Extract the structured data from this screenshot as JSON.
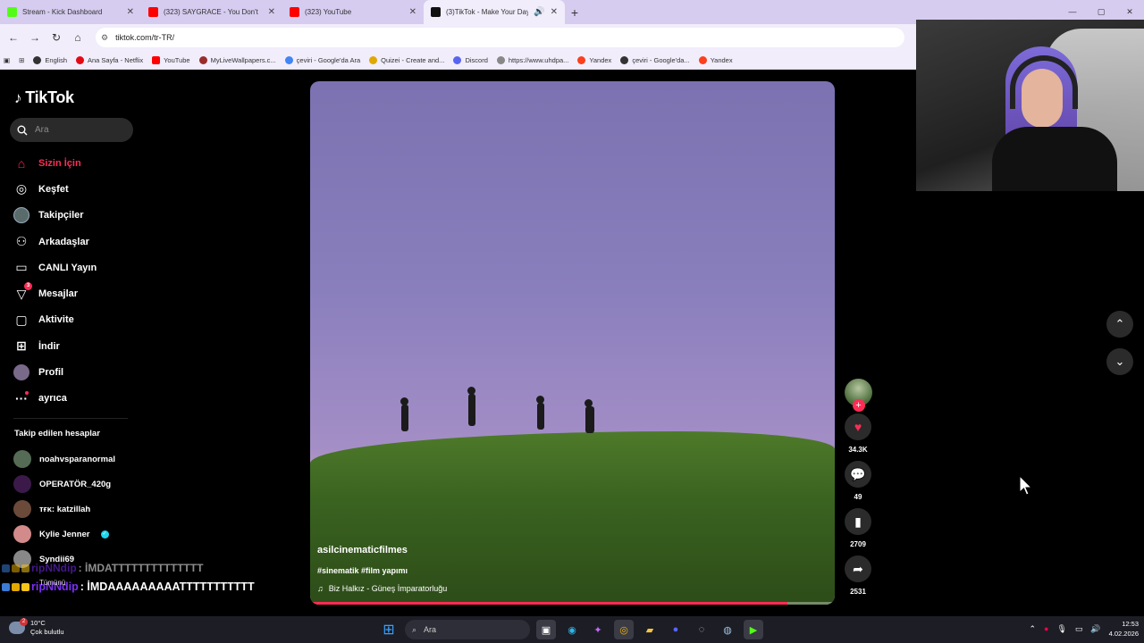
{
  "browser": {
    "tabs": [
      {
        "title": "Stream - Kick Dashboard",
        "color": "#53fc18"
      },
      {
        "title": "(323) SAYGRACE - You Don't",
        "color": "#ff0000"
      },
      {
        "title": "(323) YouTube",
        "color": "#ff0000"
      },
      {
        "title": "(3)TikTok - Make Your Day",
        "color": "#111111"
      }
    ],
    "url": "tiktok.com/tr-TR/",
    "bookmarks": [
      {
        "label": "English",
        "color": "#333333"
      },
      {
        "label": "Ana Sayfa - Netflix",
        "color": "#e50914"
      },
      {
        "label": "YouTube",
        "color": "#ff0000"
      },
      {
        "label": "MyLiveWallpapers.c...",
        "color": "#9b2c2c"
      },
      {
        "label": "çeviri - Google'da Ara",
        "color": "#4285f4"
      },
      {
        "label": "Quizei - Create and...",
        "color": "#e0a800"
      },
      {
        "label": "Discord",
        "color": "#5865f2"
      },
      {
        "label": "https://www.uhdpa...",
        "color": "#888888"
      },
      {
        "label": "Yandex",
        "color": "#fc3f1d"
      },
      {
        "label": "çeviri - Google'da...",
        "color": "#333333"
      },
      {
        "label": "Yandex",
        "color": "#fc3f1d"
      }
    ]
  },
  "sidebar": {
    "logo": "TikTok",
    "search_placeholder": "Ara",
    "menu": [
      {
        "label": "Sizin İçin",
        "icon": "home-icon",
        "glyph": "⌂",
        "active": true
      },
      {
        "label": "Keşfet",
        "icon": "compass-icon",
        "glyph": "◎"
      },
      {
        "label": "Takipçiler",
        "icon": "followers-avatar-icon",
        "glyph": "●"
      },
      {
        "label": "Arkadaşlar",
        "icon": "friends-icon",
        "glyph": "⚇"
      },
      {
        "label": "CANLI Yayın",
        "icon": "live-tv-icon",
        "glyph": "▭"
      },
      {
        "label": "Mesajlar",
        "icon": "send-icon",
        "glyph": "▽",
        "badge": "3"
      },
      {
        "label": "Aktivite",
        "icon": "activity-icon",
        "glyph": "▢"
      },
      {
        "label": "İndir",
        "icon": "download-icon",
        "glyph": "⊞"
      },
      {
        "label": "Profil",
        "icon": "profile-avatar-icon",
        "glyph": "●"
      },
      {
        "label": "ayrıca",
        "icon": "more-icon",
        "glyph": "···",
        "dot": true
      }
    ],
    "following_title": "Takip edilen hesaplar",
    "following": [
      {
        "name": "noahvsparanormal",
        "color": "#556b55"
      },
      {
        "name": "OPERATÖR_420g",
        "color": "#3b1a4a"
      },
      {
        "name": "ᴛғᴋ: katzillah",
        "color": "#6b4a3a"
      },
      {
        "name": "Kylie Jenner",
        "color": "#d28a8a",
        "verified": true
      },
      {
        "name": "Syndii69",
        "color": "#888888"
      }
    ],
    "see_all": "Tümünü"
  },
  "chat": [
    {
      "user": "ripNNdip",
      "message": ": İMDATTTTTTTTTTTTTT"
    },
    {
      "user": "ripNNdip",
      "message": ": İMDAAAAAAAAATTTTTTTTTTT"
    }
  ],
  "video": {
    "username": "asilcinematicfilmes",
    "tags": "#sinematik #film yapımı",
    "music": "Biz Halkız - Güneş İmparatorluğu",
    "progress": 0.91
  },
  "actions": {
    "likes": "34.3K",
    "comments": "49",
    "saves": "2709",
    "shares": "2531"
  },
  "taskbar": {
    "weather_temp": "10°C",
    "weather_desc": "Çok bulutlu",
    "weather_badge": "2",
    "search_label": "Ara",
    "time": "12:53",
    "date": "4.02.2026"
  },
  "colors": {
    "accent": "#fe2c55",
    "browser_tabbar": "#d6ccf0",
    "taskbar": "#1c1d25"
  }
}
